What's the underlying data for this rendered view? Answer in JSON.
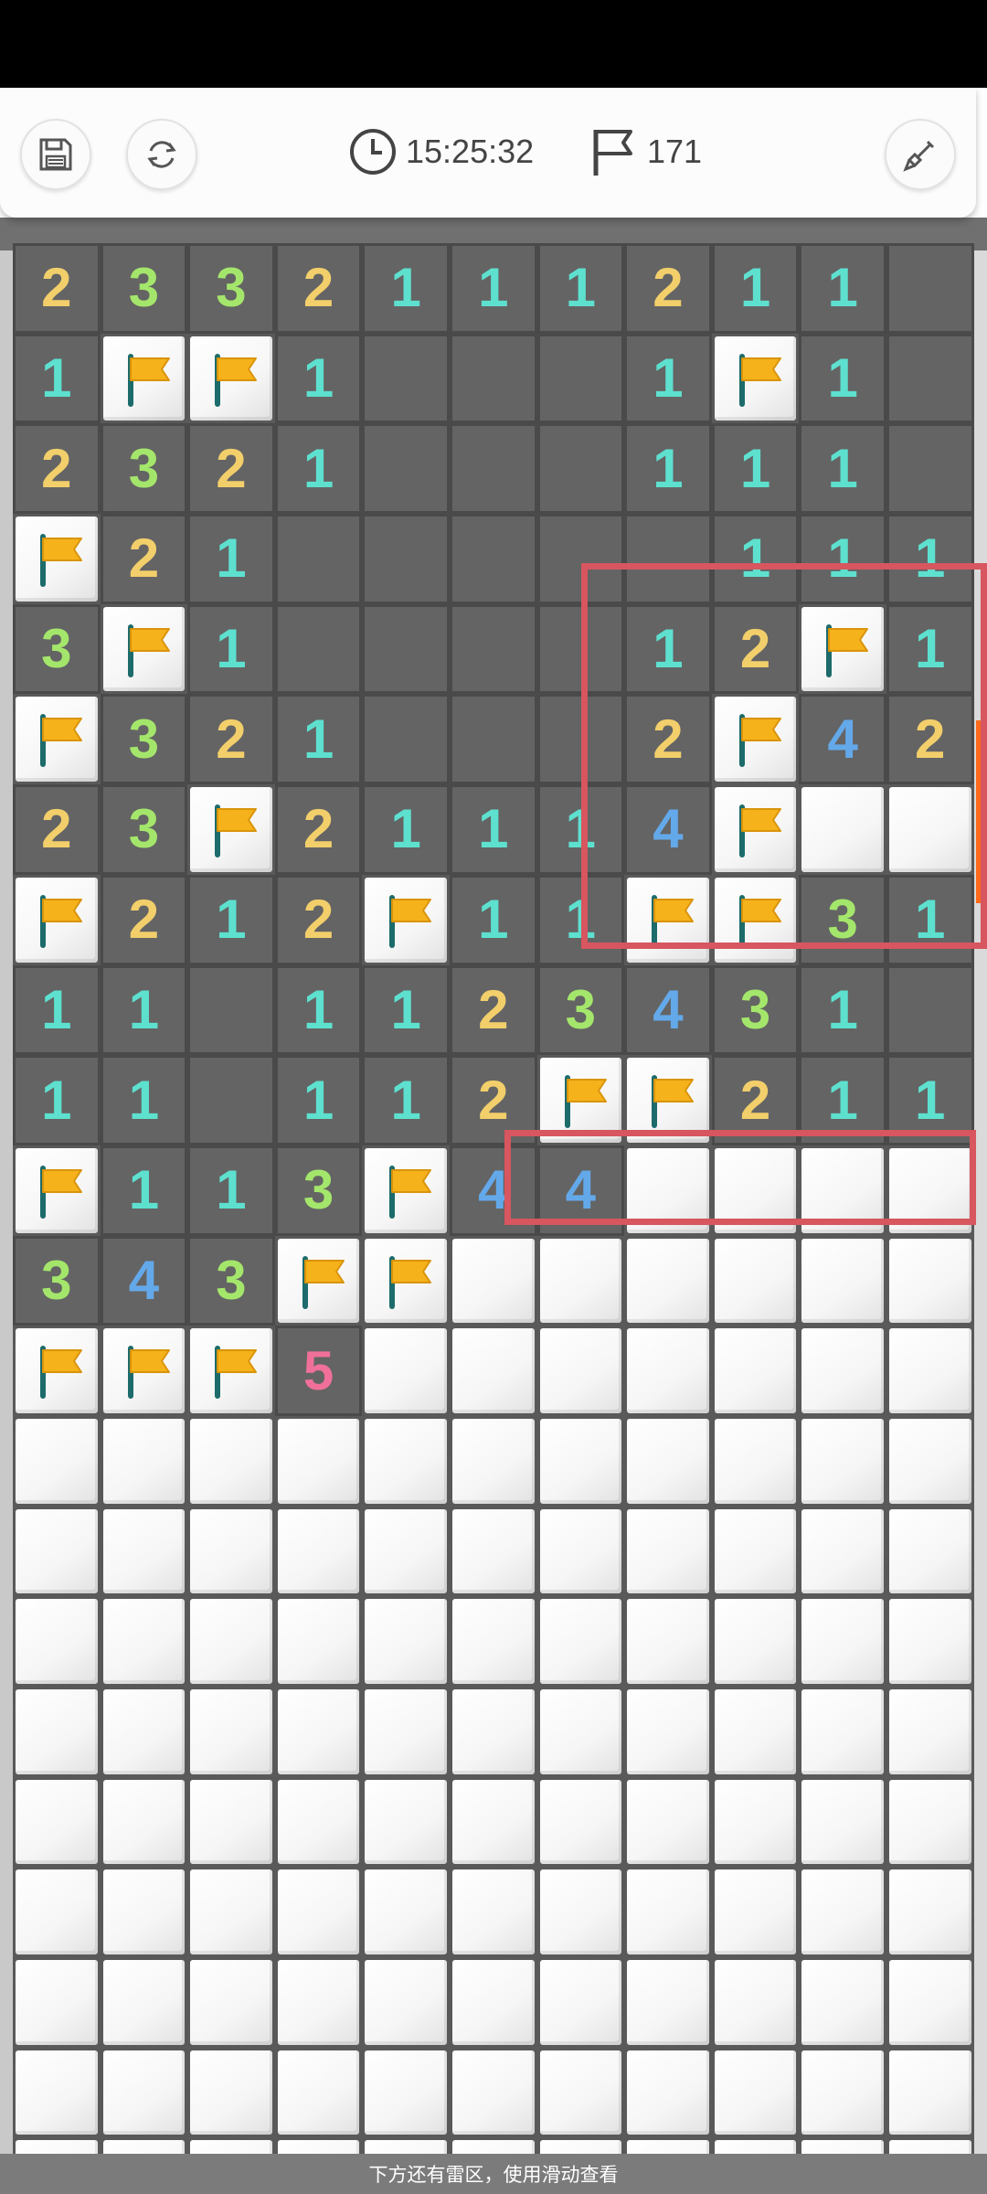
{
  "status_bar": {},
  "toolbar": {
    "timer": "15:25:32",
    "flags_remaining": "171",
    "buttons": [
      {
        "name": "save-button",
        "icon": "save-disk-icon"
      },
      {
        "name": "restart-button",
        "icon": "refresh-icon"
      },
      {
        "name": "tool-button",
        "icon": "shovel-icon"
      }
    ],
    "icons": {
      "timer": "clock-icon",
      "flags": "flag-outline-icon"
    }
  },
  "colors": {
    "num_1": "#5ee0cf",
    "num_2": "#f2cf6b",
    "num_3": "#a4e66b",
    "num_4": "#63a9ea",
    "num_5": "#f0709a",
    "flag": "#f6b21a",
    "highlight": "#d7565f",
    "accent": "#ff6a1a"
  },
  "board": {
    "legend": "numbers = revealed count, F = flag, . = revealed blank, # = unrevealed",
    "rows": [
      [
        "2",
        "3",
        "3",
        "2",
        "1",
        "1",
        "1",
        "2",
        "1",
        "1",
        "."
      ],
      [
        "1",
        "F",
        "F",
        "1",
        ".",
        ".",
        ".",
        "1",
        "F",
        "1",
        "."
      ],
      [
        "2",
        "3",
        "2",
        "1",
        ".",
        ".",
        ".",
        "1",
        "1",
        "1",
        "."
      ],
      [
        "F",
        "2",
        "1",
        ".",
        ".",
        ".",
        ".",
        ".",
        "1",
        "1",
        "1"
      ],
      [
        "3",
        "F",
        "1",
        ".",
        ".",
        ".",
        ".",
        "1",
        "2",
        "F",
        "1"
      ],
      [
        "F",
        "3",
        "2",
        "1",
        ".",
        ".",
        ".",
        "2",
        "F",
        "4",
        "2"
      ],
      [
        "2",
        "3",
        "F",
        "2",
        "1",
        "1",
        "1",
        "4",
        "F",
        "#",
        "#"
      ],
      [
        "F",
        "2",
        "1",
        "2",
        "F",
        "1",
        "1",
        "F",
        "F",
        "3",
        "1"
      ],
      [
        "1",
        "1",
        ".",
        "1",
        "1",
        "2",
        "3",
        "4",
        "3",
        "1",
        "."
      ],
      [
        "1",
        "1",
        ".",
        "1",
        "1",
        "2",
        "F",
        "F",
        "2",
        "1",
        "1"
      ],
      [
        "F",
        "1",
        "1",
        "3",
        "F",
        "4",
        "4",
        "#",
        "#",
        "#",
        "#"
      ],
      [
        "3",
        "4",
        "3",
        "F",
        "F",
        "#",
        "#",
        "#",
        "#",
        "#",
        "#"
      ],
      [
        "F",
        "F",
        "F",
        "5",
        "#",
        "#",
        "#",
        "#",
        "#",
        "#",
        "#"
      ],
      [
        "#",
        "#",
        "#",
        "#",
        "#",
        "#",
        "#",
        "#",
        "#",
        "#",
        "#"
      ],
      [
        "#",
        "#",
        "#",
        "#",
        "#",
        "#",
        "#",
        "#",
        "#",
        "#",
        "#"
      ],
      [
        "#",
        "#",
        "#",
        "#",
        "#",
        "#",
        "#",
        "#",
        "#",
        "#",
        "#"
      ],
      [
        "#",
        "#",
        "#",
        "#",
        "#",
        "#",
        "#",
        "#",
        "#",
        "#",
        "#"
      ],
      [
        "#",
        "#",
        "#",
        "#",
        "#",
        "#",
        "#",
        "#",
        "#",
        "#",
        "#"
      ],
      [
        "#",
        "#",
        "#",
        "#",
        "#",
        "#",
        "#",
        "#",
        "#",
        "#",
        "#"
      ],
      [
        "#",
        "#",
        "#",
        "#",
        "#",
        "#",
        "#",
        "#",
        "#",
        "#",
        "#"
      ],
      [
        "#",
        "#",
        "#",
        "#",
        "#",
        "#",
        "#",
        "#",
        "#",
        "#",
        "#"
      ],
      [
        "#",
        "#",
        "#",
        "#",
        "#",
        "#",
        "#",
        "#",
        "#",
        "#",
        "#"
      ]
    ]
  },
  "bottom_hint": "下方还有雷区，使用滑动查看"
}
